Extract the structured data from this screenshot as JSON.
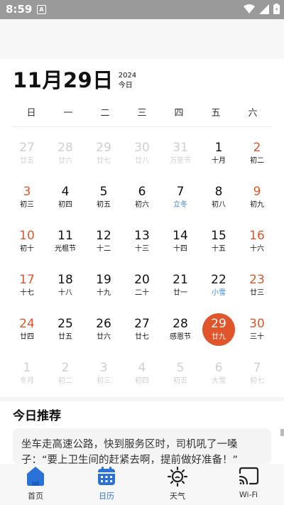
{
  "status_bar": {
    "time": "8:59",
    "notif_glyph": "A"
  },
  "header": {
    "date": "11月29日",
    "year": "2024",
    "sub": "今日"
  },
  "weekdays": [
    "日",
    "一",
    "二",
    "三",
    "四",
    "五",
    "六"
  ],
  "weeks": [
    [
      {
        "n": "27",
        "s": "廿五",
        "t": "dim"
      },
      {
        "n": "28",
        "s": "廿六",
        "t": "dim"
      },
      {
        "n": "29",
        "s": "廿七",
        "t": "dim"
      },
      {
        "n": "30",
        "s": "廿八",
        "t": "dim"
      },
      {
        "n": "31",
        "s": "万圣节",
        "t": "dim"
      },
      {
        "n": "1",
        "s": "十月",
        "t": ""
      },
      {
        "n": "2",
        "s": "初二",
        "t": "red"
      }
    ],
    [
      {
        "n": "3",
        "s": "初三",
        "t": "red"
      },
      {
        "n": "4",
        "s": "初四",
        "t": ""
      },
      {
        "n": "5",
        "s": "初五",
        "t": ""
      },
      {
        "n": "6",
        "s": "初六",
        "t": ""
      },
      {
        "n": "7",
        "s": "立冬",
        "t": "blue"
      },
      {
        "n": "8",
        "s": "初八",
        "t": ""
      },
      {
        "n": "9",
        "s": "初九",
        "t": "red"
      }
    ],
    [
      {
        "n": "10",
        "s": "初十",
        "t": "red"
      },
      {
        "n": "11",
        "s": "光棍节",
        "t": ""
      },
      {
        "n": "12",
        "s": "十二",
        "t": ""
      },
      {
        "n": "13",
        "s": "十三",
        "t": ""
      },
      {
        "n": "14",
        "s": "十四",
        "t": ""
      },
      {
        "n": "15",
        "s": "十五",
        "t": ""
      },
      {
        "n": "16",
        "s": "十六",
        "t": "red"
      }
    ],
    [
      {
        "n": "17",
        "s": "十七",
        "t": "red"
      },
      {
        "n": "18",
        "s": "十八",
        "t": ""
      },
      {
        "n": "19",
        "s": "十九",
        "t": ""
      },
      {
        "n": "20",
        "s": "二十",
        "t": ""
      },
      {
        "n": "21",
        "s": "廿一",
        "t": ""
      },
      {
        "n": "22",
        "s": "小雪",
        "t": "blue"
      },
      {
        "n": "23",
        "s": "廿三",
        "t": "red"
      }
    ],
    [
      {
        "n": "24",
        "s": "廿四",
        "t": "red"
      },
      {
        "n": "25",
        "s": "廿五",
        "t": ""
      },
      {
        "n": "26",
        "s": "廿六",
        "t": ""
      },
      {
        "n": "27",
        "s": "廿七",
        "t": ""
      },
      {
        "n": "28",
        "s": "感恩节",
        "t": ""
      },
      {
        "n": "29",
        "s": "廿九",
        "t": "selected"
      },
      {
        "n": "30",
        "s": "三十",
        "t": "red"
      }
    ],
    [
      {
        "n": "1",
        "s": "冬月",
        "t": "dim"
      },
      {
        "n": "2",
        "s": "初二",
        "t": "dim"
      },
      {
        "n": "3",
        "s": "初三",
        "t": "dim"
      },
      {
        "n": "4",
        "s": "初四",
        "t": "dim"
      },
      {
        "n": "5",
        "s": "初五",
        "t": "dim"
      },
      {
        "n": "6",
        "s": "大雪",
        "t": "dim"
      },
      {
        "n": "7",
        "s": "初七",
        "t": "dim"
      }
    ]
  ],
  "recommend": {
    "title": "今日推荐",
    "text": "坐车走高速公路，快到服务区时，司机吼了一嗓子：“要上卫生间的赶紧去啊，提前做好准备！”"
  },
  "nav": [
    {
      "label": "首页",
      "icon": "home-icon",
      "active": false
    },
    {
      "label": "日历",
      "icon": "calendar-icon",
      "active": true
    },
    {
      "label": "天气",
      "icon": "weather-sun-icon",
      "active": false
    },
    {
      "label": "Wi-Fi",
      "icon": "cast-icon",
      "active": false
    }
  ],
  "colors": {
    "accent": "#e0562a",
    "blue": "#2a72d8"
  }
}
